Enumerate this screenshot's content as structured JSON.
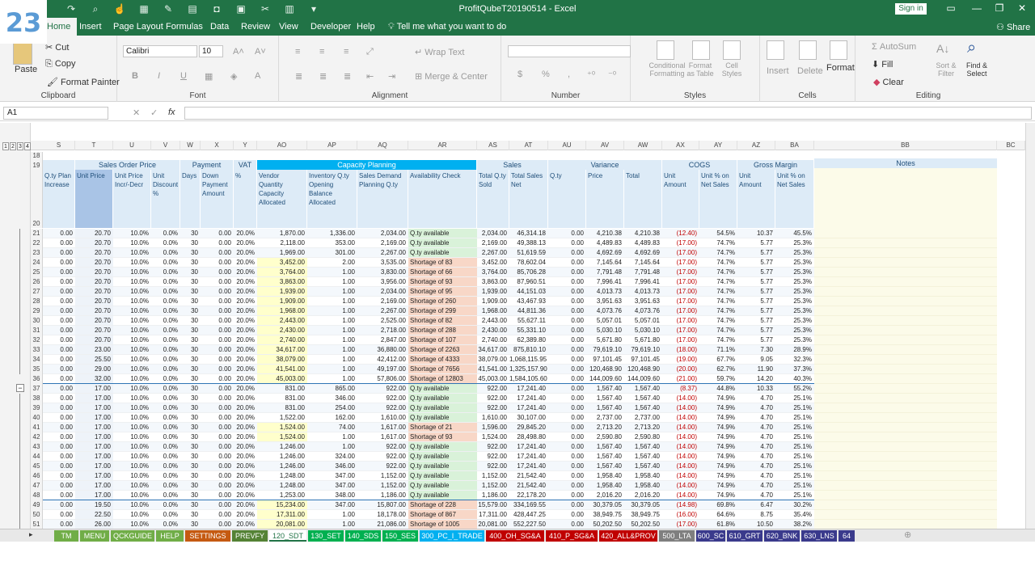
{
  "badge": "23",
  "window": {
    "title": "ProfitQubeT20190514  -  Excel",
    "signin": "Sign in",
    "share": "Share"
  },
  "ribbon_tabs": [
    "Home",
    "Insert",
    "Page Layout",
    "Formulas",
    "Data",
    "Review",
    "View",
    "Developer",
    "Help"
  ],
  "tell_me": "Tell me what you want to do",
  "clipboard": {
    "paste": "Paste",
    "cut": "Cut",
    "copy": "Copy",
    "format_painter": "Format Painter",
    "label": "Clipboard"
  },
  "font": {
    "name": "Calibri",
    "size": "10",
    "label": "Font"
  },
  "alignment": {
    "wrap": "Wrap Text",
    "merge": "Merge & Center",
    "label": "Alignment"
  },
  "number": {
    "label": "Number",
    "percent": "%",
    "comma": ","
  },
  "styles": {
    "conditional": "Conditional Formatting",
    "format_table": "Format as Table",
    "cell_styles": "Cell Styles",
    "label": "Styles"
  },
  "cells": {
    "insert": "Insert",
    "delete": "Delete",
    "format": "Format",
    "label": "Cells"
  },
  "editing": {
    "autosum": "AutoSum",
    "fill": "Fill",
    "clear": "Clear",
    "sort": "Sort & Filter",
    "find": "Find & Select",
    "label": "Editing"
  },
  "namebox": "A1",
  "fx": "fx",
  "outline_levels": [
    "1",
    "2",
    "3",
    "4"
  ],
  "columns": [
    "S",
    "T",
    "U",
    "V",
    "W",
    "X",
    "Y",
    "AO",
    "AP",
    "AQ",
    "AR",
    "AS",
    "AT",
    "AU",
    "AV",
    "AW",
    "AX",
    "AY",
    "AZ",
    "BA",
    "BB",
    "BC"
  ],
  "groups": {
    "sales_order_price": "Sales Order Price",
    "payment": "Payment",
    "vat": "VAT",
    "capacity": "Capacity Planning",
    "sales": "Sales",
    "variance": "Variance",
    "cogs": "COGS",
    "gross_margin": "Gross Margin",
    "notes": "Notes"
  },
  "subheaders": [
    "Q.ty Plan Increase",
    "Unit Price",
    "Unit Price Incr/-Decr",
    "Unit Discount %",
    "Days",
    "Down Payment Amount",
    "%",
    "Vendor Quantity Capacity Allocated",
    "Inventory Q.ty Opening Balance Allocated",
    "Sales Demand Planning Q.ty",
    "Availability Check",
    "Total Q.ty Sold",
    "Total Sales Net",
    "Q.ty",
    "Price",
    "Total",
    "Unit Amount",
    "Unit % on Net Sales",
    "Unit Amount",
    "Unit % on Net Sales"
  ],
  "rows": [
    {
      "n": "21",
      "t": "20.70",
      "vq": "1,870.00",
      "inv": "1,336.00",
      "dem": "2,034.00",
      "av": "Q.ty available",
      "tq": "2,034.00",
      "ts": "46,314.18",
      "pr": "4,210.38",
      "tot": "4,210.38",
      "cu": "(12.40)",
      "cp": "54.5%",
      "gu": "10.37",
      "gp": "45.5%"
    },
    {
      "n": "22",
      "t": "20.70",
      "vq": "2,118.00",
      "inv": "353.00",
      "dem": "2,169.00",
      "av": "Q.ty available",
      "tq": "2,169.00",
      "ts": "49,388.13",
      "pr": "4,489.83",
      "tot": "4,489.83",
      "cu": "(17.00)",
      "cp": "74.7%",
      "gu": "5.77",
      "gp": "25.3%"
    },
    {
      "n": "23",
      "t": "20.70",
      "vq": "1,969.00",
      "inv": "301.00",
      "dem": "2,267.00",
      "av": "Q.ty available",
      "tq": "2,267.00",
      "ts": "51,619.59",
      "pr": "4,692.69",
      "tot": "4,692.69",
      "cu": "(17.00)",
      "cp": "74.7%",
      "gu": "5.77",
      "gp": "25.3%"
    },
    {
      "n": "24",
      "t": "20.70",
      "vq": "3,452.00",
      "inv": "2.00",
      "dem": "3,535.00",
      "av": "Shortage of 83",
      "tq": "3,452.00",
      "ts": "78,602.04",
      "pr": "7,145.64",
      "tot": "7,145.64",
      "cu": "(17.00)",
      "cp": "74.7%",
      "gu": "5.77",
      "gp": "25.3%"
    },
    {
      "n": "25",
      "t": "20.70",
      "vq": "3,764.00",
      "inv": "1.00",
      "dem": "3,830.00",
      "av": "Shortage of 66",
      "tq": "3,764.00",
      "ts": "85,706.28",
      "pr": "7,791.48",
      "tot": "7,791.48",
      "cu": "(17.00)",
      "cp": "74.7%",
      "gu": "5.77",
      "gp": "25.3%"
    },
    {
      "n": "26",
      "t": "20.70",
      "vq": "3,863.00",
      "inv": "1.00",
      "dem": "3,956.00",
      "av": "Shortage of 93",
      "tq": "3,863.00",
      "ts": "87,960.51",
      "pr": "7,996.41",
      "tot": "7,996.41",
      "cu": "(17.00)",
      "cp": "74.7%",
      "gu": "5.77",
      "gp": "25.3%"
    },
    {
      "n": "27",
      "t": "20.70",
      "vq": "1,939.00",
      "inv": "1.00",
      "dem": "2,034.00",
      "av": "Shortage of 95",
      "tq": "1,939.00",
      "ts": "44,151.03",
      "pr": "4,013.73",
      "tot": "4,013.73",
      "cu": "(17.00)",
      "cp": "74.7%",
      "gu": "5.77",
      "gp": "25.3%"
    },
    {
      "n": "28",
      "t": "20.70",
      "vq": "1,909.00",
      "inv": "1.00",
      "dem": "2,169.00",
      "av": "Shortage of 260",
      "tq": "1,909.00",
      "ts": "43,467.93",
      "pr": "3,951.63",
      "tot": "3,951.63",
      "cu": "(17.00)",
      "cp": "74.7%",
      "gu": "5.77",
      "gp": "25.3%"
    },
    {
      "n": "29",
      "t": "20.70",
      "vq": "1,968.00",
      "inv": "1.00",
      "dem": "2,267.00",
      "av": "Shortage of 299",
      "tq": "1,968.00",
      "ts": "44,811.36",
      "pr": "4,073.76",
      "tot": "4,073.76",
      "cu": "(17.00)",
      "cp": "74.7%",
      "gu": "5.77",
      "gp": "25.3%"
    },
    {
      "n": "30",
      "t": "20.70",
      "vq": "2,443.00",
      "inv": "1.00",
      "dem": "2,525.00",
      "av": "Shortage of 82",
      "tq": "2,443.00",
      "ts": "55,627.11",
      "pr": "5,057.01",
      "tot": "5,057.01",
      "cu": "(17.00)",
      "cp": "74.7%",
      "gu": "5.77",
      "gp": "25.3%"
    },
    {
      "n": "31",
      "t": "20.70",
      "vq": "2,430.00",
      "inv": "1.00",
      "dem": "2,718.00",
      "av": "Shortage of 288",
      "tq": "2,430.00",
      "ts": "55,331.10",
      "pr": "5,030.10",
      "tot": "5,030.10",
      "cu": "(17.00)",
      "cp": "74.7%",
      "gu": "5.77",
      "gp": "25.3%"
    },
    {
      "n": "32",
      "t": "20.70",
      "vq": "2,740.00",
      "inv": "1.00",
      "dem": "2,847.00",
      "av": "Shortage of 107",
      "tq": "2,740.00",
      "ts": "62,389.80",
      "pr": "5,671.80",
      "tot": "5,671.80",
      "cu": "(17.00)",
      "cp": "74.7%",
      "gu": "5.77",
      "gp": "25.3%"
    },
    {
      "n": "33",
      "t": "23.00",
      "vq": "34,617.00",
      "inv": "1.00",
      "dem": "36,880.00",
      "av": "Shortage of 2263",
      "tq": "34,617.00",
      "ts": "875,810.10",
      "pr": "79,619.10",
      "tot": "79,619.10",
      "cu": "(18.00)",
      "cp": "71.1%",
      "gu": "7.30",
      "gp": "28.9%"
    },
    {
      "n": "34",
      "t": "25.50",
      "vq": "38,079.00",
      "inv": "1.00",
      "dem": "42,412.00",
      "av": "Shortage of 4333",
      "tq": "38,079.00",
      "ts": "1,068,115.95",
      "pr": "97,101.45",
      "tot": "97,101.45",
      "cu": "(19.00)",
      "cp": "67.7%",
      "gu": "9.05",
      "gp": "32.3%"
    },
    {
      "n": "35",
      "t": "29.00",
      "vq": "41,541.00",
      "inv": "1.00",
      "dem": "49,197.00",
      "av": "Shortage of 7656",
      "tq": "41,541.00",
      "ts": "1,325,157.90",
      "pr": "120,468.90",
      "tot": "120,468.90",
      "cu": "(20.00)",
      "cp": "62.7%",
      "gu": "11.90",
      "gp": "37.3%"
    },
    {
      "n": "36",
      "t": "32.00",
      "vq": "45,003.00",
      "inv": "1.00",
      "dem": "57,806.00",
      "av": "Shortage of 12803",
      "tq": "45,003.00",
      "ts": "1,584,105.60",
      "pr": "144,009.60",
      "tot": "144,009.60",
      "cu": "(21.00)",
      "cp": "59.7%",
      "gu": "14.20",
      "gp": "40.3%"
    },
    {
      "n": "37",
      "t": "17.00",
      "vq": "831.00",
      "inv": "865.00",
      "dem": "922.00",
      "av": "Q.ty available",
      "tq": "922.00",
      "ts": "17,241.40",
      "pr": "1,567.40",
      "tot": "1,567.40",
      "cu": "(8.37)",
      "cp": "44.8%",
      "gu": "10.33",
      "gp": "55.2%"
    },
    {
      "n": "38",
      "t": "17.00",
      "vq": "831.00",
      "inv": "346.00",
      "dem": "922.00",
      "av": "Q.ty available",
      "tq": "922.00",
      "ts": "17,241.40",
      "pr": "1,567.40",
      "tot": "1,567.40",
      "cu": "(14.00)",
      "cp": "74.9%",
      "gu": "4.70",
      "gp": "25.1%"
    },
    {
      "n": "39",
      "t": "17.00",
      "vq": "831.00",
      "inv": "254.00",
      "dem": "922.00",
      "av": "Q.ty available",
      "tq": "922.00",
      "ts": "17,241.40",
      "pr": "1,567.40",
      "tot": "1,567.40",
      "cu": "(14.00)",
      "cp": "74.9%",
      "gu": "4.70",
      "gp": "25.1%"
    },
    {
      "n": "40",
      "t": "17.00",
      "vq": "1,522.00",
      "inv": "162.00",
      "dem": "1,610.00",
      "av": "Q.ty available",
      "tq": "1,610.00",
      "ts": "30,107.00",
      "pr": "2,737.00",
      "tot": "2,737.00",
      "cu": "(14.00)",
      "cp": "74.9%",
      "gu": "4.70",
      "gp": "25.1%"
    },
    {
      "n": "41",
      "t": "17.00",
      "vq": "1,524.00",
      "inv": "74.00",
      "dem": "1,617.00",
      "av": "Shortage of 21",
      "tq": "1,596.00",
      "ts": "29,845.20",
      "pr": "2,713.20",
      "tot": "2,713.20",
      "cu": "(14.00)",
      "cp": "74.9%",
      "gu": "4.70",
      "gp": "25.1%"
    },
    {
      "n": "42",
      "t": "17.00",
      "vq": "1,524.00",
      "inv": "1.00",
      "dem": "1,617.00",
      "av": "Shortage of 93",
      "tq": "1,524.00",
      "ts": "28,498.80",
      "pr": "2,590.80",
      "tot": "2,590.80",
      "cu": "(14.00)",
      "cp": "74.9%",
      "gu": "4.70",
      "gp": "25.1%"
    },
    {
      "n": "43",
      "t": "17.00",
      "vq": "1,246.00",
      "inv": "1.00",
      "dem": "922.00",
      "av": "Q.ty available",
      "tq": "922.00",
      "ts": "17,241.40",
      "pr": "1,567.40",
      "tot": "1,567.40",
      "cu": "(14.00)",
      "cp": "74.9%",
      "gu": "4.70",
      "gp": "25.1%"
    },
    {
      "n": "44",
      "t": "17.00",
      "vq": "1,246.00",
      "inv": "324.00",
      "dem": "922.00",
      "av": "Q.ty available",
      "tq": "922.00",
      "ts": "17,241.40",
      "pr": "1,567.40",
      "tot": "1,567.40",
      "cu": "(14.00)",
      "cp": "74.9%",
      "gu": "4.70",
      "gp": "25.1%"
    },
    {
      "n": "45",
      "t": "17.00",
      "vq": "1,246.00",
      "inv": "346.00",
      "dem": "922.00",
      "av": "Q.ty available",
      "tq": "922.00",
      "ts": "17,241.40",
      "pr": "1,567.40",
      "tot": "1,567.40",
      "cu": "(14.00)",
      "cp": "74.9%",
      "gu": "4.70",
      "gp": "25.1%"
    },
    {
      "n": "46",
      "t": "17.00",
      "vq": "1,248.00",
      "inv": "347.00",
      "dem": "1,152.00",
      "av": "Q.ty available",
      "tq": "1,152.00",
      "ts": "21,542.40",
      "pr": "1,958.40",
      "tot": "1,958.40",
      "cu": "(14.00)",
      "cp": "74.9%",
      "gu": "4.70",
      "gp": "25.1%"
    },
    {
      "n": "47",
      "t": "17.00",
      "vq": "1,248.00",
      "inv": "347.00",
      "dem": "1,152.00",
      "av": "Q.ty available",
      "tq": "1,152.00",
      "ts": "21,542.40",
      "pr": "1,958.40",
      "tot": "1,958.40",
      "cu": "(14.00)",
      "cp": "74.9%",
      "gu": "4.70",
      "gp": "25.1%"
    },
    {
      "n": "48",
      "t": "17.00",
      "vq": "1,253.00",
      "inv": "348.00",
      "dem": "1,186.00",
      "av": "Q.ty available",
      "tq": "1,186.00",
      "ts": "22,178.20",
      "pr": "2,016.20",
      "tot": "2,016.20",
      "cu": "(14.00)",
      "cp": "74.9%",
      "gu": "4.70",
      "gp": "25.1%"
    },
    {
      "n": "49",
      "t": "19.50",
      "vq": "15,234.00",
      "inv": "347.00",
      "dem": "15,807.00",
      "av": "Shortage of 228",
      "tq": "15,579.00",
      "ts": "334,169.55",
      "pr": "30,379.05",
      "tot": "30,379.05",
      "cu": "(14.98)",
      "cp": "69.8%",
      "gu": "6.47",
      "gp": "30.2%"
    },
    {
      "n": "50",
      "t": "22.50",
      "vq": "17,311.00",
      "inv": "1.00",
      "dem": "18,178.00",
      "av": "Shortage of 867",
      "tq": "17,311.00",
      "ts": "428,447.25",
      "pr": "38,949.75",
      "tot": "38,949.75",
      "cu": "(16.00)",
      "cp": "64.6%",
      "gu": "8.75",
      "gp": "35.4%"
    },
    {
      "n": "51",
      "t": "26.00",
      "vq": "20,081.00",
      "inv": "1.00",
      "dem": "21,086.00",
      "av": "Shortage of 1005",
      "tq": "20,081.00",
      "ts": "552,227.50",
      "pr": "50,202.50",
      "tot": "50,202.50",
      "cu": "(17.00)",
      "cp": "61.8%",
      "gu": "10.50",
      "gp": "38.2%"
    }
  ],
  "common": {
    "s": "0.00",
    "u": "10.0%",
    "v": "0.0%",
    "w": "30",
    "x": "0.00",
    "y": "20.0%",
    "q": "0.00"
  },
  "header_rows": {
    "r18": "18",
    "r19": "19",
    "r20": "20"
  },
  "sheet_tabs": [
    {
      "label": "TM",
      "color": "#70ad47"
    },
    {
      "label": "MENU",
      "color": "#70ad47"
    },
    {
      "label": "QCKGUIDE",
      "color": "#70ad47"
    },
    {
      "label": "HELP",
      "color": "#70ad47"
    },
    {
      "label": "SETTINGS",
      "color": "#c55a11"
    },
    {
      "label": "PREVFY",
      "color": "#548235"
    },
    {
      "label": "120_SDT",
      "color": "#ffffff"
    },
    {
      "label": "130_SET",
      "color": "#00b050"
    },
    {
      "label": "140_SDS",
      "color": "#00b050"
    },
    {
      "label": "150_SES",
      "color": "#00b050"
    },
    {
      "label": "300_PC_I_TRADE",
      "color": "#00b0f0"
    },
    {
      "label": "400_OH_SG&A",
      "color": "#c00000"
    },
    {
      "label": "410_P_SG&A",
      "color": "#c00000"
    },
    {
      "label": "420_ALL&PROV",
      "color": "#c00000"
    },
    {
      "label": "500_LTA",
      "color": "#7f7f7f"
    },
    {
      "label": "600_SC",
      "color": "#3a3a8c"
    },
    {
      "label": "610_GRT",
      "color": "#3a3a8c"
    },
    {
      "label": "620_BNK",
      "color": "#3a3a8c"
    },
    {
      "label": "630_LNS",
      "color": "#3a3a8c"
    },
    {
      "label": "64",
      "color": "#3a3a8c"
    }
  ]
}
